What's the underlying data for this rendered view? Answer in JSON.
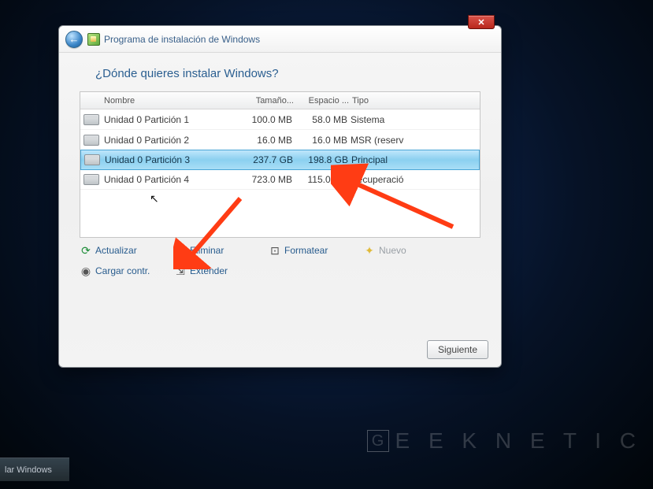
{
  "taskbar": {
    "label": "lar Windows"
  },
  "watermark": {
    "text": "E E K N E T I C",
    "initial": "G"
  },
  "window": {
    "title": "Programa de instalación de Windows",
    "heading": "¿Dónde quieres instalar Windows?",
    "columns": {
      "name": "Nombre",
      "size": "Tamaño...",
      "free": "Espacio ...",
      "type": "Tipo"
    },
    "partitions": [
      {
        "name": "Unidad 0 Partición 1",
        "size": "100.0 MB",
        "free": "58.0 MB",
        "type": "Sistema",
        "selected": false
      },
      {
        "name": "Unidad 0 Partición 2",
        "size": "16.0 MB",
        "free": "16.0 MB",
        "type": "MSR (reserv",
        "selected": false
      },
      {
        "name": "Unidad 0 Partición 3",
        "size": "237.7 GB",
        "free": "198.8 GB",
        "type": "Principal",
        "selected": true
      },
      {
        "name": "Unidad 0 Partición 4",
        "size": "723.0 MB",
        "free": "115.0 MB",
        "type": "Recuperació",
        "selected": false
      }
    ],
    "actions": {
      "refresh": "Actualizar",
      "delete": "Eliminar",
      "format": "Formatear",
      "new": "Nuevo",
      "load": "Cargar contr.",
      "extend": "Extender"
    },
    "next": "Siguiente"
  },
  "annotation": {
    "arrow_color": "#ff3c14"
  }
}
